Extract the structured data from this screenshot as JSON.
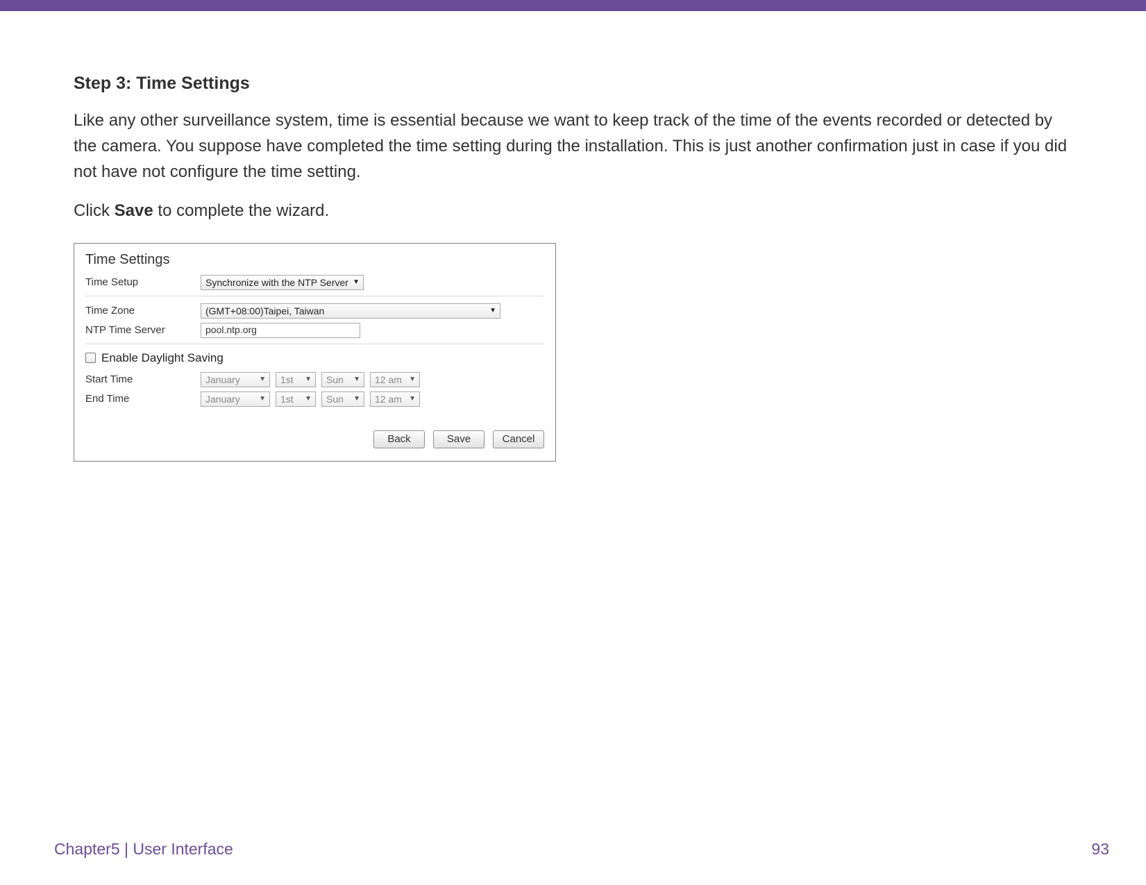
{
  "step_title": "Step 3: Time Settings",
  "para1": "Like any other surveillance system, time is essential because we want to keep track of the time of the events recorded or detected by the camera. You suppose have completed the time setting during the installation. This is just another confirmation just in case if you did not have not configure the time setting.",
  "para2_prefix": "Click ",
  "para2_bold": "Save",
  "para2_suffix": " to complete the wizard.",
  "panel": {
    "title": "Time Settings",
    "time_setup_label": "Time Setup",
    "time_setup_value": "Synchronize with the NTP Server",
    "time_zone_label": "Time Zone",
    "time_zone_value": "(GMT+08:00)Taipei, Taiwan",
    "ntp_label": "NTP Time Server",
    "ntp_value": "pool.ntp.org",
    "dst_label": "Enable Daylight Saving",
    "start_label": "Start Time",
    "end_label": "End Time",
    "month": "January",
    "day": "1st",
    "dow": "Sun",
    "hour": "12 am",
    "buttons": {
      "back": "Back",
      "save": "Save",
      "cancel": "Cancel"
    }
  },
  "footer": {
    "left": "Chapter5  |  User Interface",
    "page": "93"
  }
}
